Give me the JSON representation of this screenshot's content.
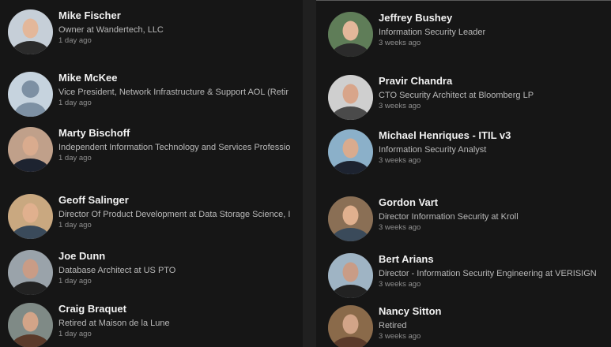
{
  "left_column": [
    {
      "name": "Mike Fischer",
      "title": "Owner at Wandertech, LLC",
      "time": "1 day ago",
      "avatar": "profile-photo"
    },
    {
      "name": "Mike McKee",
      "title": "Vice President, Network Infrastructure & Support AOL (Retir",
      "time": "1 day ago",
      "avatar": "default-avatar-icon"
    },
    {
      "name": "Marty Bischoff",
      "title": "Independent Information Technology and Services Professio",
      "time": "1 day ago",
      "avatar": "profile-photo"
    },
    {
      "name": "Geoff Salinger",
      "title": "Director Of Product Development at Data Storage Science, I",
      "time": "1 day ago",
      "avatar": "profile-photo"
    },
    {
      "name": "Joe Dunn",
      "title": "Database Architect at US PTO",
      "time": "1 day ago",
      "avatar": "profile-photo"
    },
    {
      "name": "Craig Braquet",
      "title": "Retired at Maison de la Lune",
      "time": "1 day ago",
      "avatar": "profile-photo"
    }
  ],
  "right_column": [
    {
      "name": "Jeffrey Bushey",
      "title": "Information Security Leader",
      "time": "3 weeks ago",
      "avatar": "profile-photo"
    },
    {
      "name": "Pravir Chandra",
      "title": "CTO Security Architect at Bloomberg LP",
      "time": "3 weeks ago",
      "avatar": "profile-photo"
    },
    {
      "name": "Michael Henriques - ITIL v3",
      "title": "Information Security Analyst",
      "time": "3 weeks ago",
      "avatar": "profile-photo"
    },
    {
      "name": "Gordon Vart",
      "title": "Director Information Security at Kroll",
      "time": "3 weeks ago",
      "avatar": "profile-photo"
    },
    {
      "name": "Bert Arians",
      "title": "Director - Information Security Engineering at VERISIGN",
      "time": "3 weeks ago",
      "avatar": "profile-photo"
    },
    {
      "name": "Nancy Sitton",
      "title": "Retired",
      "time": "3 weeks ago",
      "avatar": "profile-photo"
    }
  ]
}
